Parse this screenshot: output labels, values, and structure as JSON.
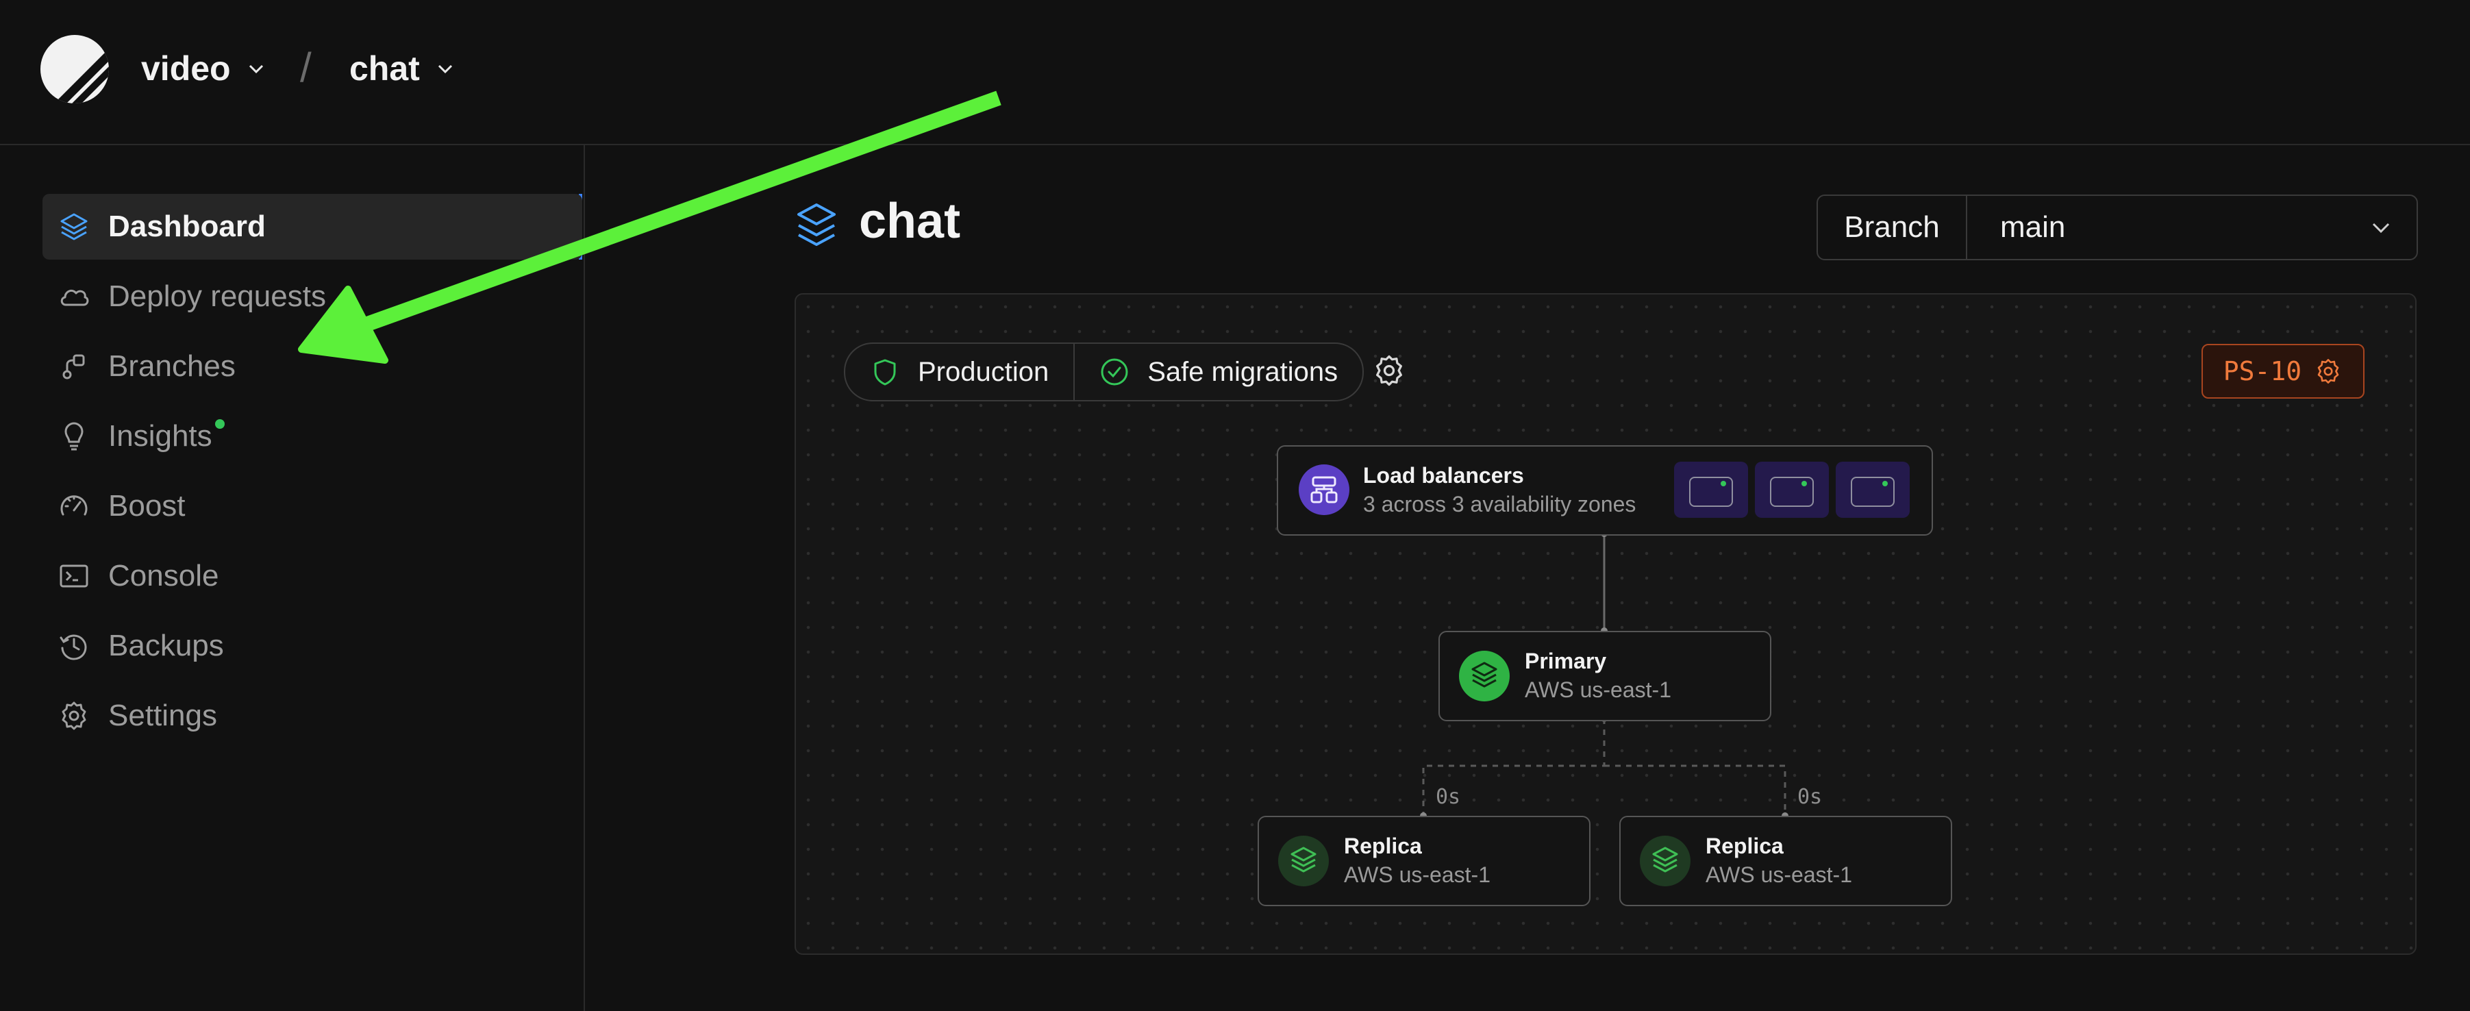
{
  "topbar": {
    "org": "video",
    "database": "chat",
    "separator": "/"
  },
  "sidebar": {
    "items": [
      {
        "label": "Dashboard",
        "icon": "layers-icon",
        "active": true
      },
      {
        "label": "Deploy requests",
        "icon": "cloud-icon"
      },
      {
        "label": "Branches",
        "icon": "branch-icon"
      },
      {
        "label": "Insights",
        "icon": "lightbulb-icon",
        "badge_dot": true
      },
      {
        "label": "Boost",
        "icon": "speedometer-icon"
      },
      {
        "label": "Console",
        "icon": "terminal-icon"
      },
      {
        "label": "Backups",
        "icon": "history-clock-icon"
      },
      {
        "label": "Settings",
        "icon": "gear-icon"
      }
    ]
  },
  "main": {
    "title": "chat",
    "branch_label": "Branch",
    "branch_value": "main"
  },
  "panel": {
    "production_label": "Production",
    "safe_migrations_label": "Safe migrations",
    "cluster_size": "PS-10",
    "load_balancers": {
      "title": "Load balancers",
      "subtitle": "3 across 3 availability zones",
      "zone_count": 3
    },
    "primary": {
      "title": "Primary",
      "region": "AWS us-east-1"
    },
    "replicas": [
      {
        "title": "Replica",
        "region": "AWS us-east-1",
        "lag": "0s"
      },
      {
        "title": "Replica",
        "region": "AWS us-east-1",
        "lag": "0s"
      }
    ]
  },
  "colors": {
    "background": "#111111",
    "accent_blue": "#3b82f6",
    "success_green": "#34c759",
    "annotation_arrow": "#5cf03a",
    "cluster_badge_orange": "#f07a3c",
    "load_balancer_purple": "#5b3fc4"
  }
}
